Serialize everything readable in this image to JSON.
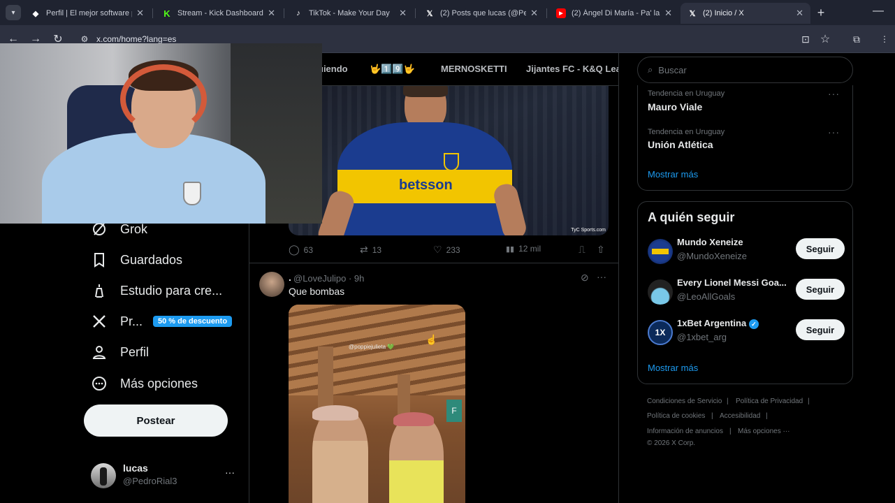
{
  "browser": {
    "tabs": [
      {
        "title": "Perfil | El mejor software p",
        "active": false
      },
      {
        "title": "Stream - Kick Dashboard",
        "active": false
      },
      {
        "title": "TikTok - Make Your Day",
        "active": false
      },
      {
        "title": "(2) Posts que lucas (@Pedr",
        "active": false
      },
      {
        "title": "(2) Ángel Di María - Pa' la",
        "active": false
      },
      {
        "title": "(2) Inicio / X",
        "active": true
      }
    ],
    "url": "x.com/home?lang=es"
  },
  "top_tabs": [
    "uiendo",
    "🤟1️⃣9️⃣🤟",
    "MERNOSKETTI",
    "Jijantes FC - K&Q Lea"
  ],
  "nav": {
    "grok": "Grok",
    "guardados": "Guardados",
    "estudio": "Estudio para cre...",
    "premium": "Pr...",
    "premium_badge": "50 % de descuento",
    "perfil": "Perfil",
    "mas": "Más opciones",
    "post_button": "Postear"
  },
  "account": {
    "name": "lucas",
    "handle": "@PedroRial3"
  },
  "post1": {
    "image_caption": "TyC Sports.com",
    "jersey_text": "betsson",
    "replies": "63",
    "reposts": "13",
    "likes": "233",
    "views": "12 mil"
  },
  "post2": {
    "author": ".",
    "handle_time": "@LoveJulipo · 9h",
    "text": "Que bombas",
    "image_tag": "@poppiejulieta 💚"
  },
  "search": {
    "placeholder": "Buscar"
  },
  "trends": [
    {
      "meta": "Tendencia en Uruguay",
      "name": "Mauro Viale"
    },
    {
      "meta": "Tendencia en Uruguay",
      "name": "Unión Atlética"
    }
  ],
  "trends_more": "Mostrar más",
  "who_to_follow": {
    "title": "A quién seguir",
    "accounts": [
      {
        "name": "Mundo Xeneize",
        "handle": "@MundoXeneize",
        "button": "Seguir"
      },
      {
        "name": "Every Lionel Messi Goa...",
        "handle": "@LeoAllGoals",
        "button": "Seguir"
      },
      {
        "name": "1xBet Argentina",
        "handle": "@1xbet_arg",
        "button": "Seguir",
        "verified": true
      }
    ],
    "more": "Mostrar más"
  },
  "footer": {
    "links": [
      "Condiciones de Servicio",
      "|",
      "Política de Privacidad",
      "|",
      "Política de cookies",
      "|",
      "Accesibilidad",
      "|",
      "Información de anuncios",
      "|",
      "Más opciones ···"
    ],
    "copyright": "© 2026 X Corp."
  },
  "colors": {
    "accent": "#1d9bf0",
    "boca_blue": "#1b3c8f",
    "boca_yellow": "#f2c500"
  }
}
